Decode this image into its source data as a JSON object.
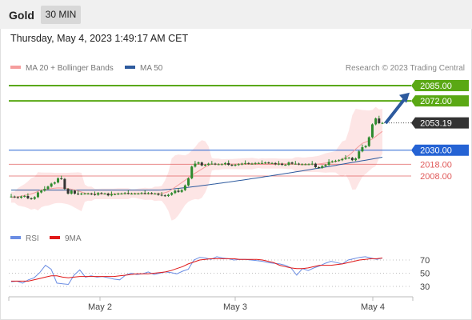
{
  "header": {
    "title": "Gold",
    "timeframe": "30 MIN"
  },
  "datetime": "Thursday, May 4, 2023 1:49:17 AM CET",
  "legend": {
    "ma20_label": "MA 20 + Bollinger Bands",
    "ma50_label": "MA 50",
    "credit": "Research © 2023 Trading Central"
  },
  "oscillator_legend": {
    "rsi_label": "RSI",
    "ma_label": "9MA"
  },
  "colors": {
    "ma20": "#f59d9d",
    "ma50": "#2d5a9e",
    "band": "#fcdcdc",
    "resistance": "#5aa814",
    "support": "#2563d4",
    "support_minor": "#e05a5a",
    "candle": "#2e8b2e",
    "current": "#333333",
    "arrow": "#2d5a9e",
    "rsi": "#6b8de3",
    "rsi_ma": "#e01818"
  },
  "chart_data": [
    {
      "type": "candlestick",
      "title": "Gold",
      "timeframe": "30 MIN",
      "x_ticks": [
        "May 2",
        "May 3",
        "May 4"
      ],
      "ylim": [
        1985,
        2092
      ],
      "levels": [
        {
          "value": 2085.0,
          "label": "2085.00",
          "kind": "resistance"
        },
        {
          "value": 2072.0,
          "label": "2072.00",
          "kind": "resistance"
        },
        {
          "value": 2053.19,
          "label": "2053.19",
          "kind": "current"
        },
        {
          "value": 2030.0,
          "label": "2030.00",
          "kind": "support"
        },
        {
          "value": 2018.0,
          "label": "2018.00",
          "kind": "support_minor"
        },
        {
          "value": 2008.0,
          "label": "2008.00",
          "kind": "support_minor"
        }
      ],
      "close_series": [
        1990.5,
        1990.0,
        1989.5,
        1990.5,
        1991.0,
        1989.0,
        1988.5,
        1990.0,
        1994.0,
        1995.5,
        1997.0,
        1999.0,
        2001.5,
        2002.5,
        2006.0,
        2005.5,
        1997.0,
        1993.0,
        1995.5,
        1993.0,
        1992.5,
        1993.0,
        1993.0,
        1993.0,
        1992.5,
        1992.0,
        1993.5,
        1993.0,
        1993.0,
        1991.5,
        1992.5,
        1992.5,
        1993.0,
        1993.0,
        1993.5,
        1993.0,
        1993.0,
        1993.0,
        1993.0,
        1993.5,
        1993.0,
        1993.5,
        1993.0,
        1993.0,
        1992.0,
        1991.5,
        1991.0,
        1992.0,
        1993.5,
        1995.5,
        1994.5,
        1996.0,
        2000.0,
        2006.0,
        2016.0,
        2018.5,
        2019.5,
        2017.0,
        2017.5,
        2018.5,
        2018.5,
        2018.0,
        2018.0,
        2018.0,
        2019.0,
        2017.5,
        2017.0,
        2017.5,
        2018.0,
        2018.5,
        2019.0,
        2018.5,
        2018.5,
        2019.0,
        2019.0,
        2019.0,
        2019.5,
        2019.0,
        2019.0,
        2018.0,
        2018.5,
        2017.5,
        2017.5,
        2019.5,
        2018.5,
        2018.5,
        2018.0,
        2018.0,
        2018.0,
        2018.0,
        2018.5,
        2015.5,
        2015.0,
        2016.5,
        2017.5,
        2020.0,
        2020.5,
        2021.0,
        2021.5,
        2022.5,
        2023.5,
        2023.5,
        2021.5,
        2023.0,
        2029.0,
        2032.5,
        2033.5,
        2041.0,
        2052.0,
        2057.0,
        2053.0,
        2053.2
      ],
      "ma20": {
        "start": 2003,
        "end": 2035
      },
      "ma50": {
        "start": 1996,
        "end": 2024
      },
      "projection": {
        "from": 2053,
        "to": 2079
      }
    },
    {
      "type": "line",
      "series": [
        {
          "name": "RSI",
          "values": [
            37,
            38,
            35,
            40,
            43,
            51,
            62,
            56,
            35,
            34,
            33,
            47,
            55,
            44,
            46,
            44,
            45,
            43,
            41,
            40,
            47,
            50,
            48,
            49,
            52,
            48,
            50,
            52,
            51,
            49,
            53,
            56,
            70,
            74,
            73,
            71,
            75,
            73,
            72,
            70,
            71,
            71,
            70,
            69,
            68,
            66,
            65,
            64,
            62,
            58,
            47,
            57,
            54,
            58,
            61,
            65,
            68,
            66,
            64,
            70,
            72,
            74,
            75,
            73,
            71,
            73
          ]
        },
        {
          "name": "9MA",
          "values": [
            38,
            38,
            38,
            38,
            40,
            42,
            44,
            46,
            46,
            44,
            43,
            44,
            45,
            45,
            45,
            45,
            45,
            45,
            45,
            46,
            47,
            48,
            49,
            49,
            49,
            50,
            51,
            52,
            54,
            57,
            60,
            64,
            67,
            70,
            71,
            72,
            72,
            72,
            72,
            72,
            71,
            71,
            71,
            71,
            70,
            68,
            66,
            62,
            60,
            58,
            57,
            57,
            58,
            60,
            62,
            62,
            62,
            63,
            64,
            66,
            68,
            70,
            71,
            72,
            72,
            73
          ]
        }
      ],
      "ylim": [
        25,
        80
      ],
      "y_ticks": [
        70,
        50,
        30
      ],
      "x_ticks": [
        "May 2",
        "May 3",
        "May 4"
      ]
    }
  ]
}
